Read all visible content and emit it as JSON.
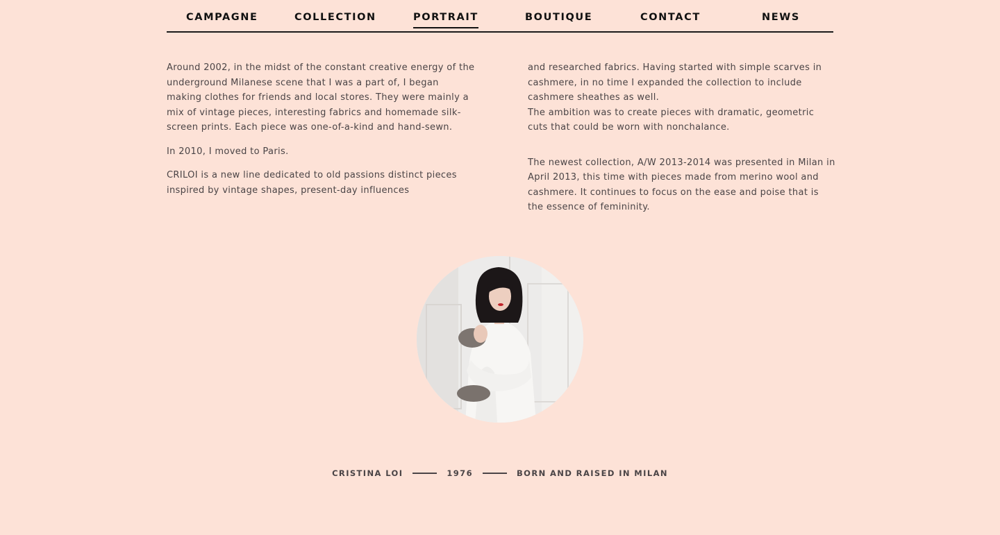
{
  "nav": {
    "items": [
      {
        "label": "CAMPAGNE",
        "active": false
      },
      {
        "label": "COLLECTION",
        "active": false
      },
      {
        "label": "PORTRAIT",
        "active": true
      },
      {
        "label": "BOUTIQUE",
        "active": false
      },
      {
        "label": "CONTACT",
        "active": false
      },
      {
        "label": "NEWS",
        "active": false
      }
    ]
  },
  "content": {
    "left": {
      "p1": "Around 2002, in the midst of the constant creative energy of the underground Milanese scene that I was a part of, I began making clothes for friends and local stores. They were mainly a mix of vintage pieces, interesting fabrics and homemade silk-screen prints. Each piece was one-of-a-kind and hand-sewn.",
      "p2": "In 2010, I moved to Paris.",
      "p3": "CRILOI is a new line dedicated to old passions distinct pieces inspired by vintage shapes, present-day influences"
    },
    "right": {
      "p1": "and researched fabrics. Having started with simple scarves in cashmere, in no time I expanded the collection to include cashmere sheathes as well.",
      "p2": "The ambition was to create pieces with dramatic, geometric cuts that could be worn with nonchalance.",
      "p3": "The newest collection, A/W 2013-2014 was presented in Milan in April 2013, this time with pieces made from merino wool and cashmere. It continues to focus on the ease and poise that is the essence of femininity."
    }
  },
  "caption": {
    "name": "CRISTINA LOI",
    "year": "1976",
    "origin": "BORN AND RAISED IN MILAN"
  },
  "colors": {
    "background": "#fde2d7",
    "text": "#4a4446",
    "nav_text": "#111111"
  }
}
